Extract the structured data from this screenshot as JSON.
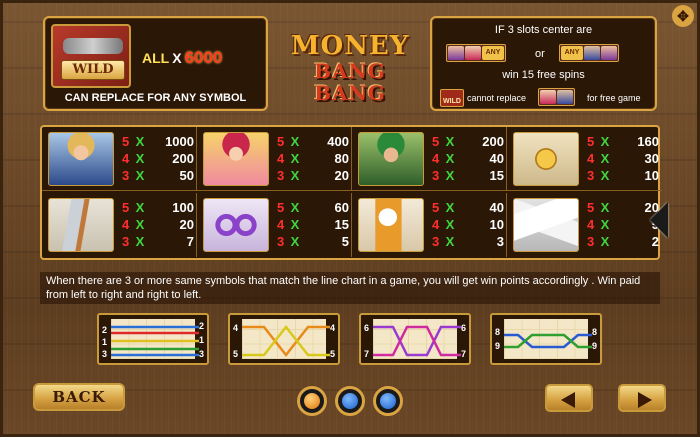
{
  "wild_panel": {
    "symbol_label": "WILD",
    "all_label": "ALL",
    "x_label": "X",
    "multiplier": "6000",
    "description": "CAN REPLACE FOR ANY SYMBOL"
  },
  "logo": {
    "line1": "MONEY",
    "line2": "BANG BANG"
  },
  "free_spin_panel": {
    "line1": "IF 3 slots center are",
    "any_label": "ANY",
    "or_label": "or",
    "line2": "win 15 free spins",
    "wild_mini_label": "WILD",
    "cannot_replace": "cannot replace",
    "for_free_game": "for free game"
  },
  "paytable": [
    {
      "symbol": "sheriff",
      "pays": [
        {
          "k": "5",
          "v": "1000"
        },
        {
          "k": "4",
          "v": "200"
        },
        {
          "k": "3",
          "v": "50"
        }
      ]
    },
    {
      "symbol": "cowgirl",
      "pays": [
        {
          "k": "5",
          "v": "400"
        },
        {
          "k": "4",
          "v": "80"
        },
        {
          "k": "3",
          "v": "20"
        }
      ]
    },
    {
      "symbol": "bandit",
      "pays": [
        {
          "k": "5",
          "v": "200"
        },
        {
          "k": "4",
          "v": "40"
        },
        {
          "k": "3",
          "v": "15"
        }
      ]
    },
    {
      "symbol": "badge",
      "pays": [
        {
          "k": "5",
          "v": "160"
        },
        {
          "k": "4",
          "v": "30"
        },
        {
          "k": "3",
          "v": "10"
        }
      ]
    },
    {
      "symbol": "bullets",
      "pays": [
        {
          "k": "5",
          "v": "100"
        },
        {
          "k": "4",
          "v": "20"
        },
        {
          "k": "3",
          "v": "7"
        }
      ]
    },
    {
      "symbol": "handcuffs",
      "pays": [
        {
          "k": "5",
          "v": "60"
        },
        {
          "k": "4",
          "v": "15"
        },
        {
          "k": "3",
          "v": "5"
        }
      ]
    },
    {
      "symbol": "beer",
      "pays": [
        {
          "k": "5",
          "v": "40"
        },
        {
          "k": "4",
          "v": "10"
        },
        {
          "k": "3",
          "v": "3"
        }
      ]
    },
    {
      "symbol": "cards",
      "pays": [
        {
          "k": "5",
          "v": "20"
        },
        {
          "k": "4",
          "v": "5"
        },
        {
          "k": "3",
          "v": "2"
        }
      ]
    }
  ],
  "x_mark": "X",
  "info_text": "When there are 3 or more same symbols that match the line chart in a game, you will get win points accordingly . Win paid from left to right and right to left.",
  "paylines": {
    "box1": {
      "left": [
        "1",
        "3"
      ],
      "right": [
        "2",
        "1",
        "3"
      ],
      "left_top": "2"
    },
    "box2": {
      "left": [
        "4",
        "5"
      ],
      "right": [
        "4",
        "5"
      ]
    },
    "box3": {
      "left": [
        "6",
        "7"
      ],
      "right": [
        "6",
        "7"
      ]
    },
    "box4": {
      "left": [
        "8",
        "9"
      ],
      "right": [
        "8",
        "9"
      ]
    }
  },
  "controls": {
    "back_label": "BACK",
    "active_page": 1,
    "page_count": 3
  },
  "colors": {
    "gold_border": "#d9a441",
    "pay_count": "#ff2f2f",
    "pay_x": "#3fd63f",
    "multiplier": "#ff3a1a",
    "logo_gold": "#f5b330",
    "logo_red": "#d63a1c"
  }
}
